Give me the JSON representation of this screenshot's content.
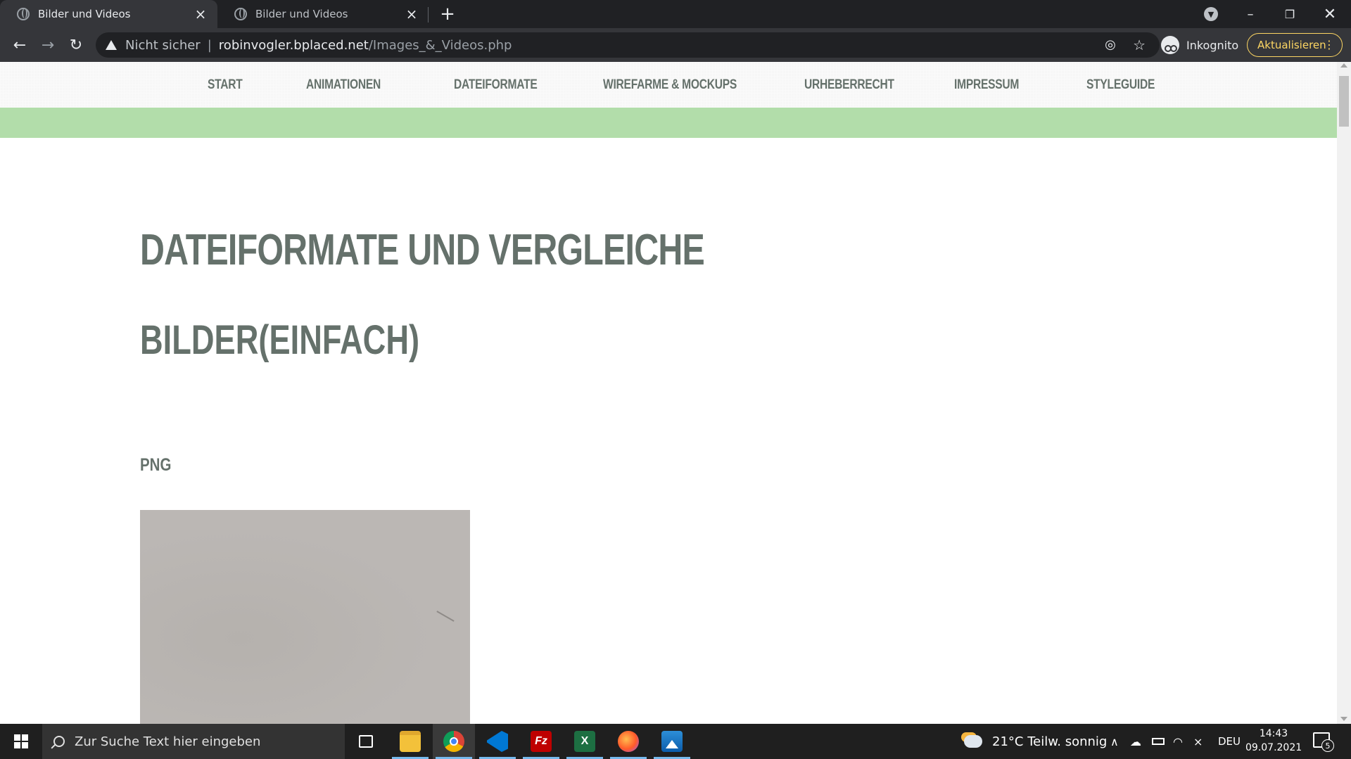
{
  "browser": {
    "tabs": [
      {
        "title": "Bilder und Videos",
        "active": true
      },
      {
        "title": "Bilder und Videos",
        "active": false
      }
    ],
    "new_tab": "+",
    "address": {
      "security_label": "Nicht sicher",
      "host": "robinvogler.bplaced.net",
      "path": "/Images_&_Videos.php"
    },
    "profile_label": "Inkognito",
    "update_button": "Aktualisieren"
  },
  "site": {
    "nav": [
      "START",
      "ANIMATIONEN",
      "DATEIFORMATE",
      "WIREFARME & MOCKUPS",
      "URHEBERRECHT",
      "IMPRESSUM",
      "STYLEGUIDE"
    ],
    "heading": "DATEIFORMATE UND VERGLEICHE",
    "subheading": "BILDER(EINFACH)",
    "section_title": "PNG",
    "colors": {
      "text": "#65716b",
      "accent_bar": "#b2ddaa"
    }
  },
  "taskbar": {
    "search_placeholder": "Zur Suche Text hier eingeben",
    "apps": [
      "task-view",
      "file-explorer",
      "chrome",
      "visual-studio-code",
      "filezilla",
      "excel",
      "firefox",
      "photos"
    ],
    "weather": "21°C  Teilw. sonnig",
    "language": "DEU",
    "time": "14:43",
    "date": "09.07.2021",
    "notification_count": "5"
  }
}
